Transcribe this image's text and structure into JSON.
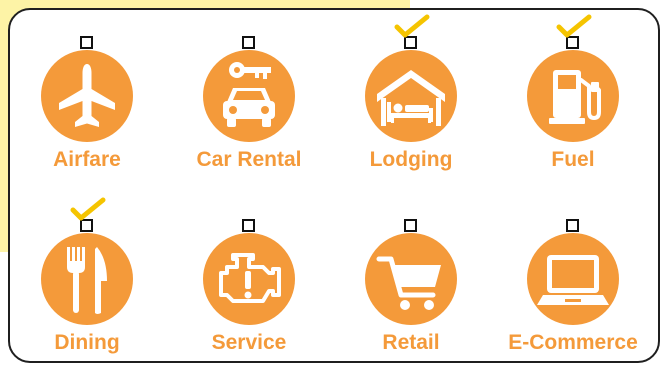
{
  "colors": {
    "accent": "#f49a3a",
    "panel_border": "#1f1f1f",
    "background_highlight": "#fdf3a6",
    "check_mark": "#f5c400",
    "icon_foreground": "#ffffff"
  },
  "categories": [
    {
      "label": "Airfare",
      "icon": "airplane-icon",
      "checked": false
    },
    {
      "label": "Car Rental",
      "icon": "car-key-icon",
      "checked": false
    },
    {
      "label": "Lodging",
      "icon": "bed-house-icon",
      "checked": true
    },
    {
      "label": "Fuel",
      "icon": "fuel-pump-icon",
      "checked": true
    },
    {
      "label": "Dining",
      "icon": "fork-knife-icon",
      "checked": true
    },
    {
      "label": "Service",
      "icon": "engine-warning-icon",
      "checked": false
    },
    {
      "label": "Retail",
      "icon": "shopping-cart-icon",
      "checked": false
    },
    {
      "label": "E-Commerce",
      "icon": "laptop-icon",
      "checked": false
    }
  ]
}
